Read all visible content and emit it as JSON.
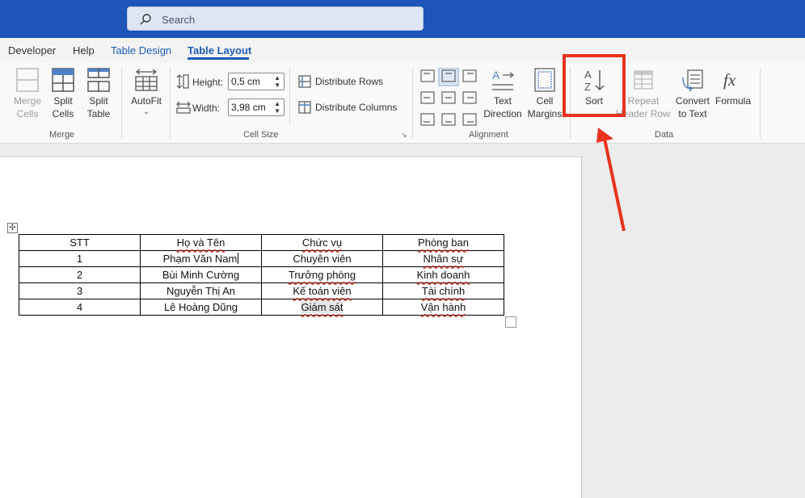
{
  "search": {
    "placeholder": "Search"
  },
  "tabs": [
    {
      "label": "Developer"
    },
    {
      "label": "Help"
    },
    {
      "label": "Table Design"
    },
    {
      "label": "Table Layout"
    }
  ],
  "ribbon": {
    "merge_group": {
      "label": "Merge",
      "merge_cells": [
        "Merge",
        "Cells"
      ],
      "split_cells": [
        "Split",
        "Cells"
      ],
      "split_table": [
        "Split",
        "Table"
      ]
    },
    "autofit": {
      "label": "AutoFit"
    },
    "cell_size": {
      "label": "Cell Size",
      "height_label": "Height:",
      "height_value": "0,5 cm",
      "width_label": "Width:",
      "width_value": "3,98 cm",
      "distribute_rows": "Distribute Rows",
      "distribute_columns": "Distribute Columns"
    },
    "alignment": {
      "label": "Alignment",
      "text_direction": [
        "Text",
        "Direction"
      ],
      "cell_margins": [
        "Cell",
        "Margins"
      ]
    },
    "data": {
      "label": "Data",
      "sort": "Sort",
      "repeat_header": [
        "Repeat",
        "Header Rows"
      ],
      "convert": [
        "Convert",
        "to Text"
      ],
      "formula": "Formula"
    }
  },
  "table": {
    "rows": [
      [
        "STT",
        "Họ và Tên",
        "Chức vụ",
        "Phòng ban"
      ],
      [
        "1",
        "Phạm Văn Nam",
        "Chuyên viên",
        "Nhân sự"
      ],
      [
        "2",
        "Bùi Minh Cường",
        "Trưởng phòng",
        "Kinh doanh"
      ],
      [
        "3",
        "Nguyễn Thị An",
        "Kế toán viên",
        "Tài chính"
      ],
      [
        "4",
        "Lê Hoàng Dũng",
        "Giám sát",
        "Vận hành"
      ]
    ]
  },
  "colors": {
    "titlebar": "#1d55b8",
    "accent": "#1d5cb5",
    "annotation": "#e8321e"
  }
}
